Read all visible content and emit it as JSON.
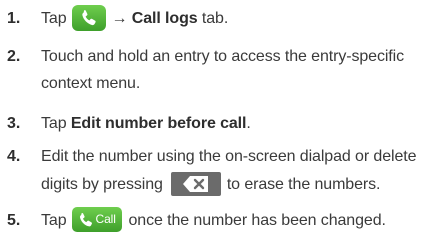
{
  "steps": [
    {
      "number": "1.",
      "tap": "Tap",
      "icon": "phone-icon",
      "arrow": "→",
      "bold": "Call logs",
      "after": " tab."
    },
    {
      "number": "2.",
      "line1": "Touch and hold an entry to access the entry-specific",
      "line2": "context menu."
    },
    {
      "number": "3.",
      "tap": "Tap",
      "bold": "Edit number before call",
      "after": "."
    },
    {
      "number": "4.",
      "line1": "Edit the number using the on-screen dialpad or delete",
      "line2_before": "digits by pressing",
      "icon": "backspace-delete-icon",
      "line2_after": "to erase the numbers."
    },
    {
      "number": "5.",
      "tap": "Tap",
      "icon": "call-button-icon",
      "icon_label": "Call",
      "after": "once the number has been changed."
    }
  ],
  "colors": {
    "text": "#3a3a3a",
    "green_button": "#4fb036",
    "delete_key": "#6b6b6b"
  }
}
